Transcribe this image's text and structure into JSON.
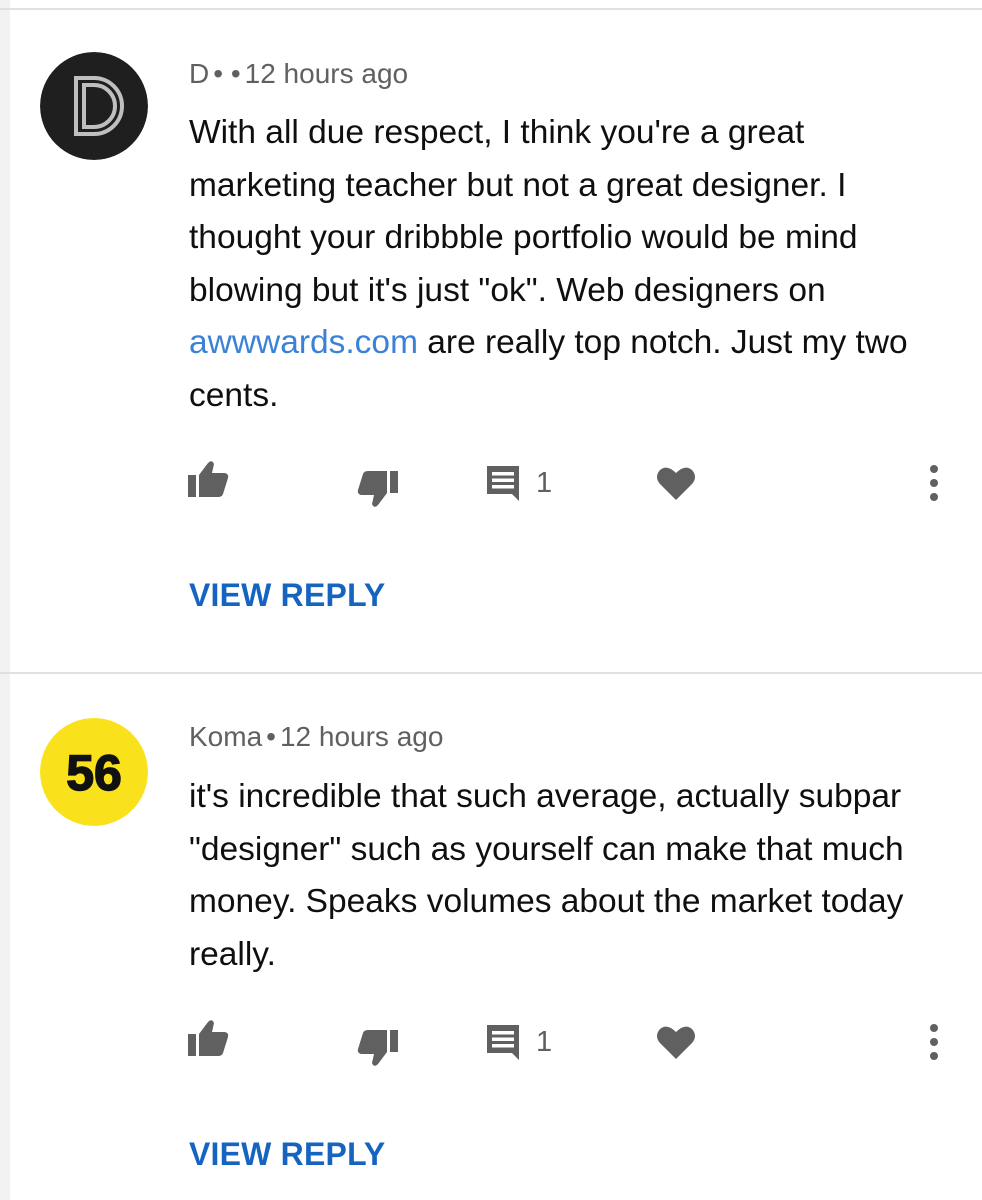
{
  "comments": [
    {
      "author": "D",
      "author_dots": "• •",
      "time": "12 hours ago",
      "avatar": {
        "icon": "d-logo-avatar",
        "bg": "#1f1f1f",
        "fg": "#bfbfbf"
      },
      "text_before": "With all due respect, I think you're a great marketing teacher but not a great designer. I thought your dribbble portfolio would be mind blowing but it's just \"ok\". Web designers on ",
      "link_text": "awwwards.com",
      "text_after": " are really top notch. Just my two cents.",
      "reply_count": "1",
      "view_reply": "VIEW REPLY"
    },
    {
      "author": "Koma",
      "author_dots": "•",
      "time": "12 hours ago",
      "avatar": {
        "icon": "number-56-avatar",
        "label": "56",
        "bg": "#f9e21b",
        "fg": "#111111"
      },
      "text_before": "it's incredible that such average, actually subpar \"designer\" such as yourself can make that much money. Speaks volumes about the market today really.",
      "link_text": "",
      "text_after": "",
      "reply_count": "1",
      "view_reply": "VIEW REPLY"
    }
  ],
  "icons": [
    "thumbs-up-icon",
    "thumbs-down-icon",
    "comment-icon",
    "heart-icon",
    "more-vert-icon"
  ],
  "colors": {
    "link": "#3b82d6",
    "view_reply": "#1565c0",
    "icon_gray": "#606060"
  }
}
